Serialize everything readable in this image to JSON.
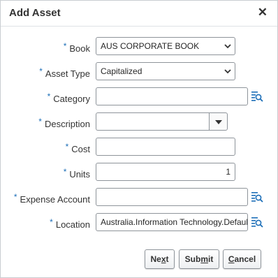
{
  "dialog": {
    "title": "Add Asset",
    "close_glyph": "✕"
  },
  "fields": {
    "book": {
      "label": "Book",
      "value": "AUS CORPORATE BOOK",
      "required": true
    },
    "asset_type": {
      "label": "Asset Type",
      "value": "Capitalized",
      "required": true
    },
    "category": {
      "label": "Category",
      "value": "",
      "required": true
    },
    "description": {
      "label": "Description",
      "value": "",
      "required": true
    },
    "cost": {
      "label": "Cost",
      "value": "",
      "required": true
    },
    "units": {
      "label": "Units",
      "value": "1",
      "required": true
    },
    "expense_account": {
      "label": "Expense Account",
      "value": "",
      "required": true
    },
    "location": {
      "label": "Location",
      "value": "Australia.Information Technology.Default",
      "required": true
    }
  },
  "required_marker": "*",
  "buttons": {
    "next": {
      "pre": "Ne",
      "access": "x",
      "post": "t"
    },
    "submit": {
      "pre": "Sub",
      "access": "m",
      "post": "it"
    },
    "cancel": {
      "pre": "",
      "access": "C",
      "post": "ancel"
    }
  },
  "colors": {
    "required": "#1d6fb8",
    "lov_icon": "#1d6fb8"
  },
  "icons": {
    "lov": "search-list-icon",
    "select": "chevron-down-icon",
    "combo": "triangle-down-icon",
    "close": "close-icon"
  }
}
